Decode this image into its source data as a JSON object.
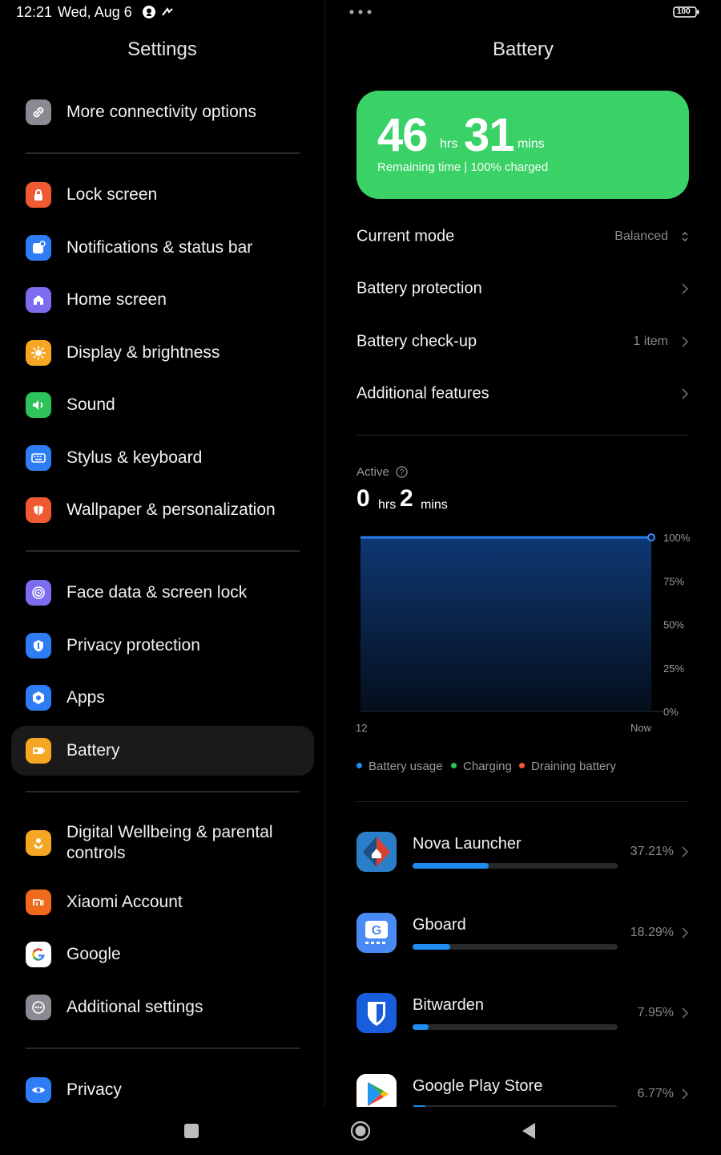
{
  "status_bar": {
    "time": "12:21",
    "date": "Wed, Aug 6",
    "battery_level": "100"
  },
  "left_panel": {
    "title": "Settings",
    "items": [
      {
        "label": "More connectivity options",
        "icon": "link-icon",
        "color": "#8a8a93"
      },
      {
        "label": "Lock screen",
        "icon": "lock-icon",
        "color": "#f05a32"
      },
      {
        "label": "Notifications & status bar",
        "icon": "notification-icon",
        "color": "#2f7df6"
      },
      {
        "label": "Home screen",
        "icon": "home-icon",
        "color": "#7b6cf0"
      },
      {
        "label": "Display & brightness",
        "icon": "sun-icon",
        "color": "#f5a623"
      },
      {
        "label": "Sound",
        "icon": "speaker-icon",
        "color": "#2ec25a"
      },
      {
        "label": "Stylus & keyboard",
        "icon": "keyboard-icon",
        "color": "#2f7df6"
      },
      {
        "label": "Wallpaper & personalization",
        "icon": "wallpaper-icon",
        "color": "#f05a32"
      },
      {
        "label": "Face data & screen lock",
        "icon": "face-icon",
        "color": "#7b6cf0"
      },
      {
        "label": "Privacy protection",
        "icon": "shield-icon",
        "color": "#2f7df6"
      },
      {
        "label": "Apps",
        "icon": "apps-icon",
        "color": "#2f7df6"
      },
      {
        "label": "Battery",
        "icon": "battery-icon",
        "color": "#f5a623"
      },
      {
        "label": "Digital Wellbeing & parental controls",
        "icon": "wellbeing-icon",
        "color": "#f5a623"
      },
      {
        "label": "Xiaomi Account",
        "icon": "mi-icon",
        "color": "#f06a1e"
      },
      {
        "label": "Google",
        "icon": "google-icon",
        "color": "#ffffff"
      },
      {
        "label": "Additional settings",
        "icon": "more-icon",
        "color": "#8a8a93"
      },
      {
        "label": "Privacy",
        "icon": "eye-icon",
        "color": "#2f7df6"
      }
    ]
  },
  "right_panel": {
    "title": "Battery",
    "summary": {
      "hours": "46",
      "hours_unit": "hrs",
      "minutes": "31",
      "minutes_unit": "mins",
      "subtitle": "Remaining time | 100% charged",
      "color": "#3ad167"
    },
    "rows": [
      {
        "label": "Current mode",
        "value": "Balanced"
      },
      {
        "label": "Battery protection",
        "value": ""
      },
      {
        "label": "Battery check-up",
        "value": "1 item"
      },
      {
        "label": "Additional features",
        "value": ""
      }
    ],
    "active": {
      "label": "Active",
      "hours": "0",
      "hours_unit": "hrs",
      "minutes": "2",
      "minutes_unit": "mins"
    },
    "legend": [
      {
        "label": "Battery usage",
        "color": "#1e8cf0"
      },
      {
        "label": "Charging",
        "color": "#2ec25a"
      },
      {
        "label": "Draining battery",
        "color": "#f05a32"
      }
    ],
    "apps": [
      {
        "name": "Nova Launcher",
        "percent": "37.21%",
        "value": 37.21
      },
      {
        "name": "Gboard",
        "percent": "18.29%",
        "value": 18.29
      },
      {
        "name": "Bitwarden",
        "percent": "7.95%",
        "value": 7.95
      },
      {
        "name": "Google Play Store",
        "percent": "6.77%",
        "value": 6.77
      }
    ]
  },
  "chart_data": {
    "type": "area",
    "x_ticks": [
      "12",
      "Now"
    ],
    "y_ticks": [
      "100%",
      "75%",
      "50%",
      "25%",
      "0%"
    ],
    "ylim": [
      0,
      100
    ],
    "grid": true,
    "series": [
      {
        "values": [
          100,
          100
        ]
      }
    ]
  }
}
